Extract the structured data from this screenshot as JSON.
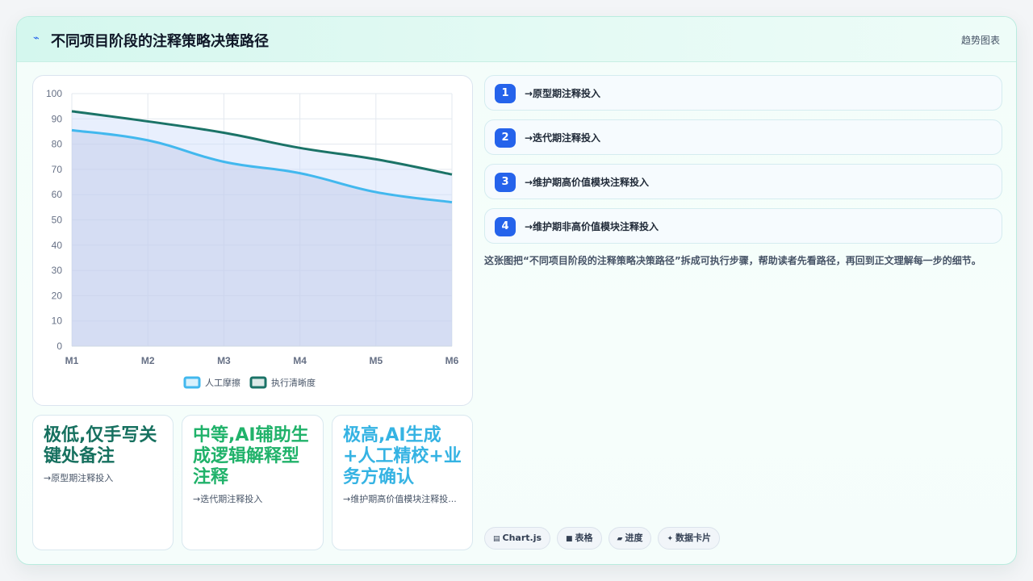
{
  "header": {
    "icon": "trend-icon",
    "title": "不同项目阶段的注释策略决策路径",
    "tag": "趋势图表"
  },
  "chart_data": {
    "type": "area",
    "categories": [
      "M1",
      "M2",
      "M3",
      "M4",
      "M5",
      "M6"
    ],
    "series": [
      {
        "name": "人工摩擦",
        "values": [
          85.5,
          81.5,
          73,
          68.5,
          61,
          57
        ],
        "color": "#42b8ee"
      },
      {
        "name": "执行清晰度",
        "values": [
          93,
          89,
          84.5,
          78.5,
          74,
          68
        ],
        "color": "#1b7367"
      }
    ],
    "ylim": [
      0,
      100
    ],
    "yticks": [
      0,
      10,
      20,
      30,
      40,
      50,
      60,
      70,
      80,
      90,
      100
    ],
    "grid": true,
    "legend_position": "bottom"
  },
  "stats": [
    {
      "value": "极低,仅手写关键处备注",
      "label": "→原型期注释投入",
      "color": "#16705f"
    },
    {
      "value": "中等,AI辅助生成逻辑解释型注释",
      "label": "→迭代期注释投入",
      "color": "#20b26a"
    },
    {
      "value": "极高,AI生成+人工精校+业务方确认",
      "label": "→维护期高价值模块注释投...",
      "color": "#35b3e3"
    }
  ],
  "steps": [
    {
      "num": "1",
      "label": "→原型期注释投入"
    },
    {
      "num": "2",
      "label": "→迭代期注释投入"
    },
    {
      "num": "3",
      "label": "→维护期高价值模块注释投入"
    },
    {
      "num": "4",
      "label": "→维护期非高价值模块注释投入"
    }
  ],
  "description": "这张图把“不同项目阶段的注释策略决策路径”拆成可执行步骤，帮助读者先看路径，再回到正文理解每一步的细节。",
  "chips": [
    {
      "icon": "chart-icon",
      "glyph": "▤",
      "label": "Chart.js"
    },
    {
      "icon": "table-icon",
      "glyph": "■",
      "label": "表格"
    },
    {
      "icon": "progress-icon",
      "glyph": "▰",
      "label": "进度"
    },
    {
      "icon": "sparkle-icon",
      "glyph": "✦",
      "label": "数据卡片"
    }
  ]
}
